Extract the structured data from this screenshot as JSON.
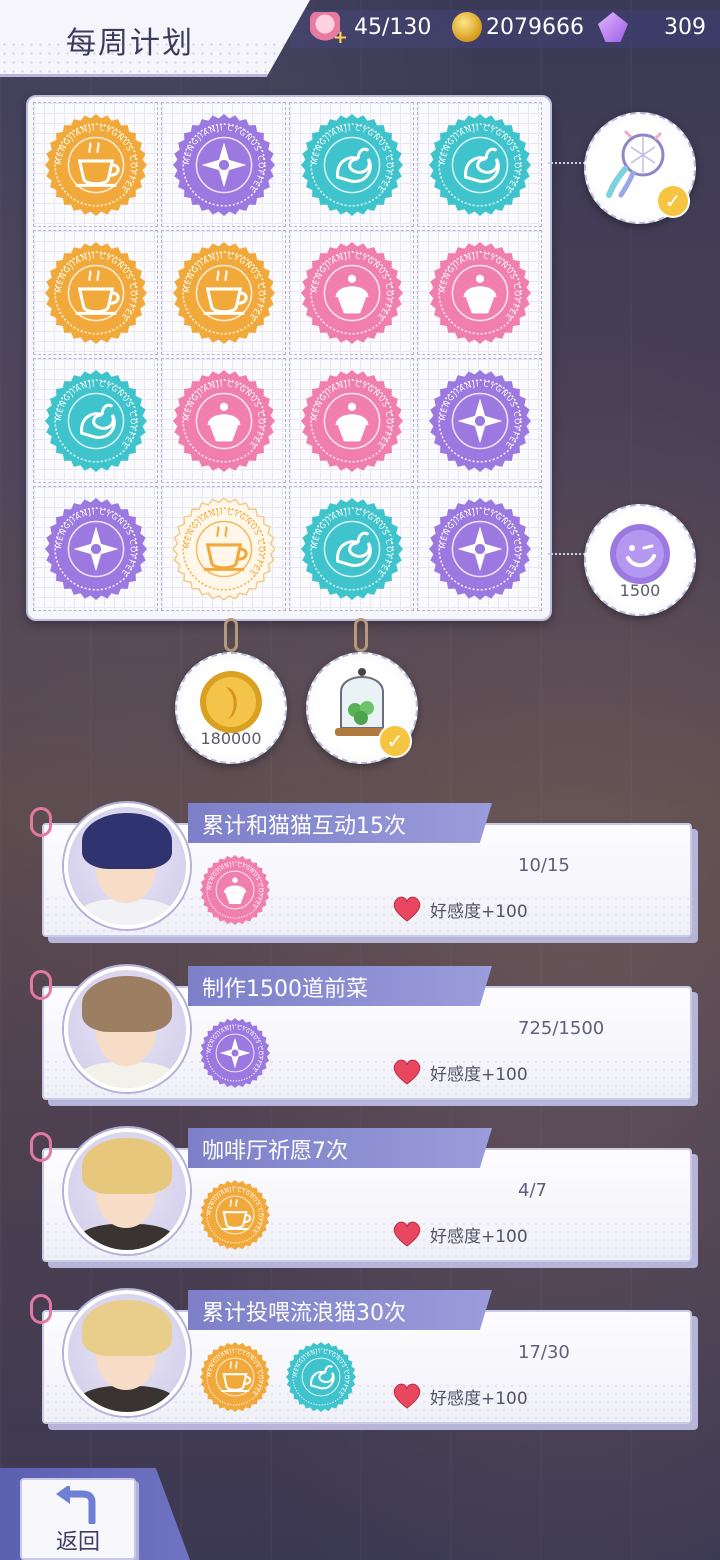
{
  "header": {
    "title": "每周计划",
    "resources": [
      {
        "icon": "cake-plus-icon",
        "value": "45/130"
      },
      {
        "icon": "gold-coin-icon",
        "value": "2079666"
      },
      {
        "icon": "purple-gem-plus-icon",
        "value": "309"
      }
    ]
  },
  "board": {
    "stamp_text": "MENGJIANJI CYGNUS COFFEE",
    "colors": {
      "orange": "#f2a93b",
      "purple": "#9b79e0",
      "teal": "#3fc3cc",
      "pink": "#f07fae"
    },
    "cells": [
      [
        "orange-coffee",
        "purple-compass",
        "teal-swan",
        "teal-swan"
      ],
      [
        "orange-coffee",
        "orange-coffee",
        "pink-cupcake",
        "pink-cupcake"
      ],
      [
        "teal-swan",
        "pink-cupcake",
        "pink-cupcake",
        "purple-compass"
      ],
      [
        "purple-compass",
        "outline-coffee",
        "teal-swan",
        "purple-compass"
      ]
    ]
  },
  "rewards": {
    "row1": {
      "icon": "dreamcatcher-icon",
      "claimed": true
    },
    "row4": {
      "icon": "purple-token-icon",
      "label": "1500",
      "claimed": false
    },
    "col1": {
      "icon": "gold-coin-icon",
      "label": "180000",
      "claimed": false
    },
    "col2": {
      "icon": "clover-jar-icon",
      "claimed": true
    }
  },
  "tasks": [
    {
      "title": "累计和猫猫互动15次",
      "progress": "10/15",
      "stamps": [
        "pink-cupcake"
      ],
      "reward": "好感度+100",
      "hair": "#2f3470",
      "shirt": "#f2f2f6"
    },
    {
      "title": "制作1500道前菜",
      "progress": "725/1500",
      "stamps": [
        "purple-compass"
      ],
      "reward": "好感度+100",
      "hair": "#9c7f63",
      "shirt": "#f4f1ea"
    },
    {
      "title": "咖啡厅祈愿7次",
      "progress": "4/7",
      "stamps": [
        "orange-coffee"
      ],
      "reward": "好感度+100",
      "hair": "#e6c77c",
      "shirt": "#3a3331"
    },
    {
      "title": "累计投喂流浪猫30次",
      "progress": "17/30",
      "stamps": [
        "orange-coffee",
        "teal-swan"
      ],
      "reward": "好感度+100",
      "hair": "#e8cd8b",
      "shirt": "#3a3331"
    }
  ],
  "back": {
    "label": "返回"
  }
}
